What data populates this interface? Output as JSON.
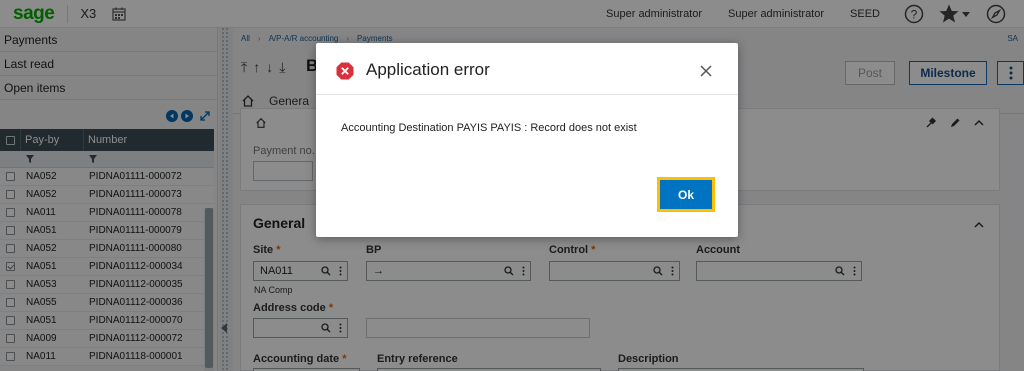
{
  "topbar": {
    "logo": "sage",
    "product": "X3",
    "user1": "Super administrator",
    "user2": "Super administrator",
    "folder": "SEED"
  },
  "left_panel": {
    "items": [
      {
        "label": "Payments"
      },
      {
        "label": "Last read"
      },
      {
        "label": "Open items"
      }
    ],
    "grid": {
      "headers": [
        "Pay-by",
        "Number"
      ],
      "rows": [
        {
          "payby": "NA052",
          "number": "PIDNA01111-000072",
          "checked": false
        },
        {
          "payby": "NA052",
          "number": "PIDNA01111-000073",
          "checked": false
        },
        {
          "payby": "NA011",
          "number": "PIDNA01111-000078",
          "checked": false
        },
        {
          "payby": "NA051",
          "number": "PIDNA01111-000079",
          "checked": false
        },
        {
          "payby": "NA052",
          "number": "PIDNA01111-000080",
          "checked": false
        },
        {
          "payby": "NA051",
          "number": "PIDNA01112-000034",
          "checked": true
        },
        {
          "payby": "NA053",
          "number": "PIDNA01112-000035",
          "checked": false
        },
        {
          "payby": "NA055",
          "number": "PIDNA01112-000036",
          "checked": false
        },
        {
          "payby": "NA051",
          "number": "PIDNA01112-000070",
          "checked": false
        },
        {
          "payby": "NA009",
          "number": "PIDNA01112-000072",
          "checked": false
        },
        {
          "payby": "NA011",
          "number": "PIDNA01118-000001",
          "checked": false
        }
      ]
    }
  },
  "main": {
    "breadcrumb": [
      "All",
      "A/P-A/R accounting",
      "Payments"
    ],
    "sa_label": "SA",
    "title": "B",
    "post_label": "Post",
    "milestone_label": "Milestone",
    "tab_general": "Genera",
    "section1": {
      "payment_label": "Payment no."
    },
    "section2": {
      "title": "General",
      "site_label": "Site",
      "site_value": "NA011",
      "site_sub": "NA Comp",
      "bp_label": "BP",
      "bp_value": "→",
      "control_label": "Control",
      "account_label": "Account",
      "address_label": "Address code",
      "accdate_label": "Accounting date",
      "entryref_label": "Entry reference",
      "description_label": "Description",
      "required_mark": "*"
    }
  },
  "dialog": {
    "title": "Application error",
    "message": "Accounting Destination PAYIS PAYIS : Record does not exist",
    "ok_label": "Ok"
  },
  "colors": {
    "brand_green": "#00b000",
    "accent_blue": "#0073c2",
    "error_red": "#d9303c",
    "focus_yellow": "#ffbe00",
    "required_orange": "#e96400"
  }
}
